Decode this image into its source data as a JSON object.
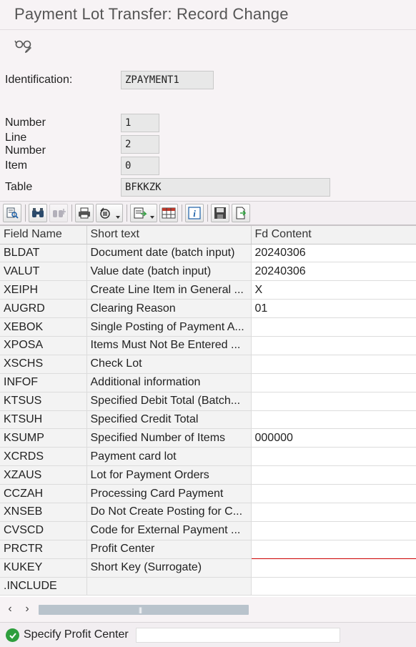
{
  "header": {
    "title": "Payment Lot Transfer:  Record Change"
  },
  "form": {
    "identification": {
      "label": "Identification:",
      "value": "ZPAYMENT1"
    },
    "number": {
      "label": "Number",
      "value": "1"
    },
    "line_number": {
      "label": "Line Number",
      "value": "2"
    },
    "item": {
      "label": "Item",
      "value": "0"
    },
    "table": {
      "label": "Table",
      "value": "BFKKZK"
    }
  },
  "grid": {
    "columns": [
      "Field Name",
      "Short text",
      "Fd Content"
    ],
    "rows": [
      {
        "field": "BLDAT",
        "text": "Document date (batch input)",
        "content": "20240306"
      },
      {
        "field": "VALUT",
        "text": "Value date (batch input)",
        "content": "20240306"
      },
      {
        "field": "XEIPH",
        "text": "Create Line Item in General ...",
        "content": "X"
      },
      {
        "field": "AUGRD",
        "text": "Clearing Reason",
        "content": "01"
      },
      {
        "field": "XEBOK",
        "text": "Single Posting of Payment A...",
        "content": ""
      },
      {
        "field": "XPOSA",
        "text": "Items Must Not Be Entered ...",
        "content": ""
      },
      {
        "field": "XSCHS",
        "text": "Check Lot",
        "content": ""
      },
      {
        "field": "INFOF",
        "text": "Additional information",
        "content": ""
      },
      {
        "field": "KTSUS",
        "text": "Specified Debit Total (Batch...",
        "content": ""
      },
      {
        "field": "KTSUH",
        "text": "Specified Credit Total",
        "content": ""
      },
      {
        "field": "KSUMP",
        "text": "Specified Number of Items",
        "content": "000000"
      },
      {
        "field": "XCRDS",
        "text": "Payment card lot",
        "content": ""
      },
      {
        "field": "XZAUS",
        "text": "Lot for Payment Orders",
        "content": ""
      },
      {
        "field": "CCZAH",
        "text": "Processing Card Payment",
        "content": ""
      },
      {
        "field": "XNSEB",
        "text": "Do Not Create Posting for C...",
        "content": ""
      },
      {
        "field": "CVSCD",
        "text": "Code for External Payment ...",
        "content": ""
      },
      {
        "field": "PRCTR",
        "text": "Profit Center",
        "content": ""
      },
      {
        "field": "KUKEY",
        "text": "Short Key (Surrogate)",
        "content": ""
      },
      {
        "field": ".INCLUDE",
        "text": "",
        "content": ""
      }
    ]
  },
  "status": {
    "message": "Specify Profit Center",
    "type": "success"
  },
  "colors": {
    "success": "#2e9e3d",
    "accent": "#1b5fa8"
  },
  "icons": [
    "display-glasses-icon",
    "detail-icon",
    "find-icon",
    "find-next-icon",
    "print-icon",
    "export-icon",
    "layout-icon",
    "grid-layout-icon",
    "info-icon",
    "save-icon",
    "export-file-icon",
    "success-check-icon"
  ]
}
